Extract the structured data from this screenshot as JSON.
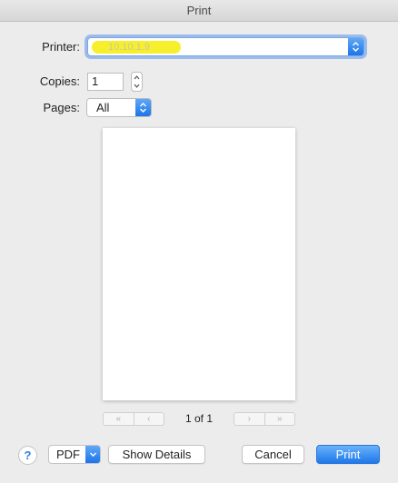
{
  "window": {
    "title": "Print"
  },
  "printer": {
    "label": "Printer:",
    "value": "10.10.1.9"
  },
  "copies": {
    "label": "Copies:",
    "value": "1"
  },
  "pages": {
    "label": "Pages:",
    "value": "All"
  },
  "preview": {
    "first_icon": "«",
    "prev_icon": "‹",
    "next_icon": "›",
    "last_icon": "»",
    "page_indicator": "1 of 1"
  },
  "footer": {
    "help_label": "?",
    "pdf_label": "PDF",
    "show_details_label": "Show Details",
    "cancel_label": "Cancel",
    "print_label": "Print"
  },
  "colors": {
    "accent": "#1e78ea",
    "highlight": "#f7ef2c"
  }
}
